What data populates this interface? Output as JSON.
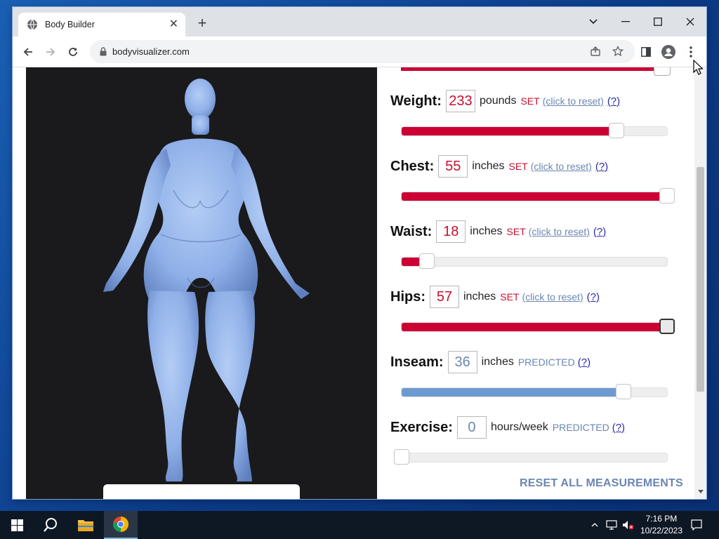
{
  "browser": {
    "tab_title": "Body Builder",
    "url": "bodyvisualizer.com"
  },
  "measurements": [
    {
      "key": "weight",
      "label": "Weight:",
      "value": "233",
      "unit": "pounds",
      "status": "SET",
      "reset": "(click to reset)",
      "help": "(?)",
      "slider_fraction": 0.81,
      "fill_color": "#cc0033",
      "mode": "set"
    },
    {
      "key": "chest",
      "label": "Chest:",
      "value": "55",
      "unit": "inches",
      "status": "SET",
      "reset": "(click to reset)",
      "help": "(?)",
      "slider_fraction": 1.0,
      "fill_color": "#cc0033",
      "mode": "set"
    },
    {
      "key": "waist",
      "label": "Waist:",
      "value": "18",
      "unit": "inches",
      "status": "SET",
      "reset": "(click to reset)",
      "help": "(?)",
      "slider_fraction": 0.096,
      "fill_color": "#cc0033",
      "mode": "set"
    },
    {
      "key": "hips",
      "label": "Hips:",
      "value": "57",
      "unit": "inches",
      "status": "SET",
      "reset": "(click to reset)",
      "help": "(?)",
      "slider_fraction": 1.0,
      "fill_color": "#cc0033",
      "mode": "set"
    },
    {
      "key": "inseam",
      "label": "Inseam:",
      "value": "36",
      "unit": "inches",
      "status": "PREDICTED",
      "help": "(?)",
      "slider_fraction": 0.836,
      "fill_color": "#6e9ad2",
      "mode": "pred"
    },
    {
      "key": "exercise",
      "label": "Exercise:",
      "value": "0",
      "unit": "hours/week",
      "status": "PREDICTED",
      "help": "(?)",
      "slider_fraction": 0.0,
      "fill_color": "#6e9ad2",
      "mode": "pred"
    }
  ],
  "reset_all": "RESET ALL MEASUREMENTS",
  "taskbar": {
    "time": "7:16 PM",
    "date": "10/22/2023"
  },
  "colors": {
    "set_red": "#c8102e",
    "predicted_blue": "#6a86b2",
    "model_blue": "#8fb0e8"
  }
}
